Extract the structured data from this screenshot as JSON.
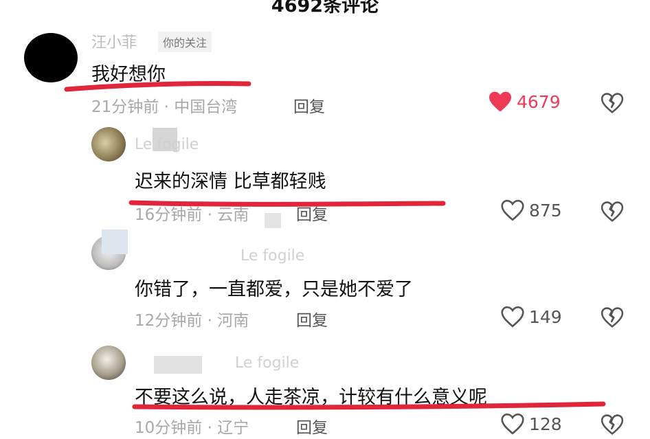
{
  "header": {
    "title": "4692条评论"
  },
  "colors": {
    "liked": "#ee3a57",
    "underline": "#e0263a"
  },
  "comments": [
    {
      "author": "汪小菲",
      "tag": "你的关注",
      "text": "我好想你",
      "meta": "21分钟前 · 中国台湾",
      "reply": "回复",
      "likes": "4679",
      "liked": true
    },
    {
      "author": "Le fogile",
      "text": "迟来的深情  比草都轻贱",
      "meta": "16分钟前 · 云南",
      "reply": "回复",
      "likes": "875",
      "liked": false
    },
    {
      "author": "Le fogile",
      "text": "你错了，一直都爱，只是她不爱了",
      "meta": "12分钟前 · 河南",
      "reply": "回复",
      "likes": "149",
      "liked": false
    },
    {
      "author": "Le fogile",
      "text": "不要这么说，人走茶凉，计较有什么意义呢",
      "meta": "10分钟前 · 辽宁",
      "reply": "回复",
      "likes": "128",
      "liked": false
    }
  ],
  "icons": {
    "like": "heart-icon",
    "dislike": "broken-heart-icon"
  }
}
